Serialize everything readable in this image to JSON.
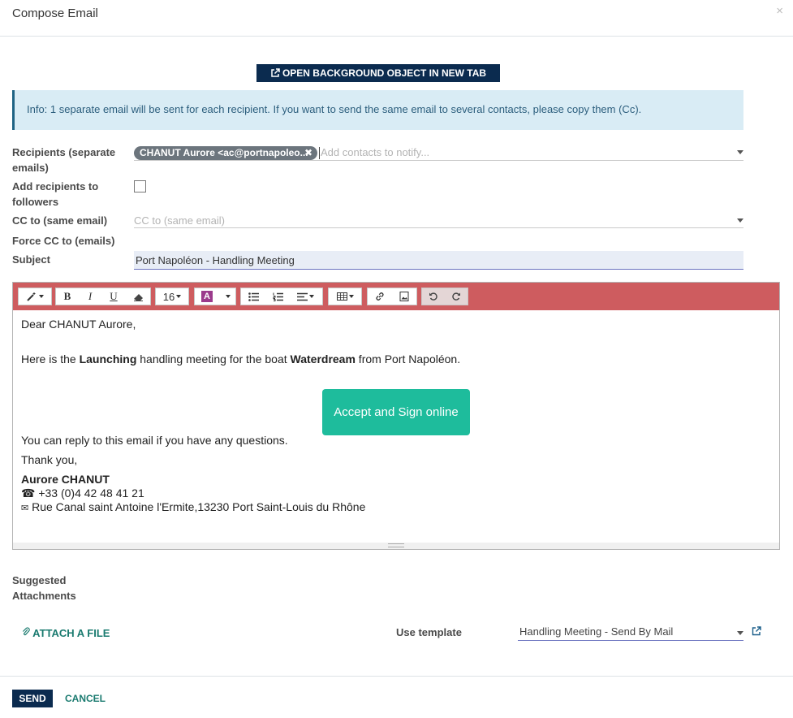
{
  "dialog": {
    "title": "Compose Email",
    "close_glyph": "×"
  },
  "open_bg_button": {
    "label": "OPEN BACKGROUND OBJECT IN NEW TAB",
    "icon": "external-link-icon"
  },
  "info": {
    "text": "Info: 1 separate email will be sent for each recipient. If you want to send the same email to several contacts, please copy them (Cc)."
  },
  "form": {
    "recipients": {
      "label_line1": "Recipients (separate",
      "label_line2": "emails)",
      "chip": "CHANUT Aurore <ac@portnapoleo...",
      "placeholder": "Add contacts to notify..."
    },
    "add_followers": {
      "label_line1": "Add recipients to",
      "label_line2": "followers",
      "checked": false
    },
    "cc": {
      "label": "CC to (same email)",
      "placeholder": "CC to (same email)"
    },
    "force_cc": {
      "label": "Force CC to (emails)"
    },
    "subject": {
      "label": "Subject",
      "value": "Port Napoléon - Handling Meeting"
    }
  },
  "toolbar": {
    "font_size": "16",
    "color_letter": "A"
  },
  "body": {
    "greeting": "Dear CHANUT Aurore,",
    "line_pre": "Here is the ",
    "line_bold1": "Launching",
    "line_mid": " handling meeting for the boat ",
    "line_bold2": "Waterdream",
    "line_post": " from Port Napoléon.",
    "sign_button": "Accept and Sign online",
    "reply": "You can reply to this email if you have any questions.",
    "thanks": "Thank you,",
    "signature_name": "Aurore CHANUT",
    "phone_glyph": "☎",
    "phone": "+33 (0)4 42 48 41 21",
    "mail_glyph": "✉",
    "address": "Rue Canal saint Antoine l'Ermite,13230 Port Saint-Louis du Rhône"
  },
  "attachments": {
    "label_line1": "Suggested",
    "label_line2": "Attachments",
    "attach_link": "ATTACH A FILE"
  },
  "template": {
    "label": "Use template",
    "value": "Handling Meeting - Send By Mail"
  },
  "footer": {
    "send": "SEND",
    "cancel": "CANCEL"
  },
  "colors": {
    "navy": "#0b2b4f",
    "teal": "#1ebc9c",
    "toolbar": "#ce5c5f",
    "info_bg": "#d9ecf5"
  }
}
